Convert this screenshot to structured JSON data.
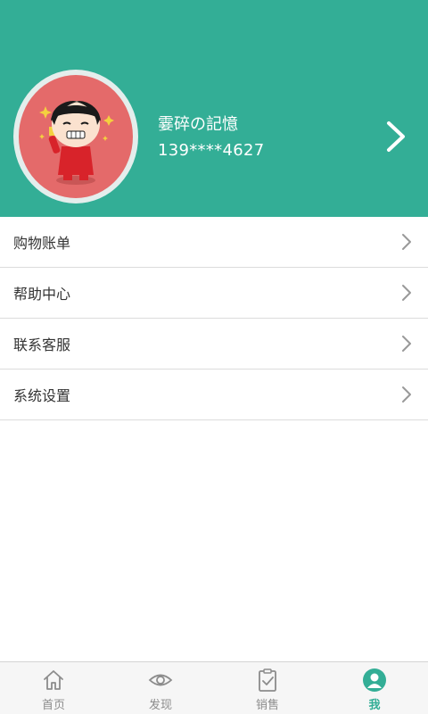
{
  "profile": {
    "name": "霎碎の記憶",
    "phone": "139****4627",
    "avatar_icon": "cartoon-girl-avatar"
  },
  "menu": {
    "items": [
      {
        "label": "购物账单",
        "icon": "chevron-right-icon"
      },
      {
        "label": "帮助中心",
        "icon": "chevron-right-icon"
      },
      {
        "label": "联系客服",
        "icon": "chevron-right-icon"
      },
      {
        "label": "系统设置",
        "icon": "chevron-right-icon"
      }
    ]
  },
  "tabbar": {
    "tabs": [
      {
        "label": "首页",
        "icon": "home-icon",
        "active": false
      },
      {
        "label": "发现",
        "icon": "eye-icon",
        "active": false
      },
      {
        "label": "销售",
        "icon": "clipboard-check-icon",
        "active": false
      },
      {
        "label": "我",
        "icon": "person-icon",
        "active": true
      }
    ]
  },
  "colors": {
    "header_bg": "#33ae96",
    "accent": "#33ae96",
    "tab_inactive": "#8c8c8c"
  }
}
